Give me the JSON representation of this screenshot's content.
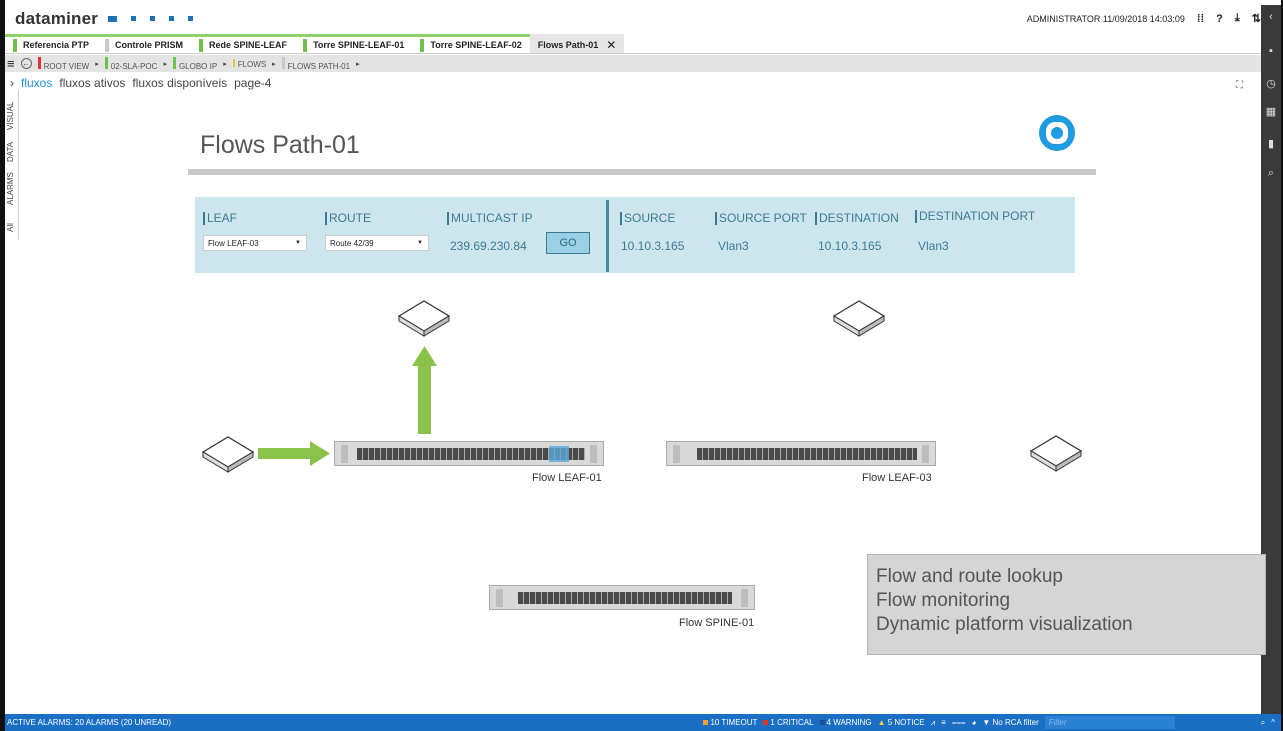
{
  "app": {
    "logo": "dataminer",
    "user_info": "ADMINISTRATOR 11/09/2018 14:03:09",
    "top_icons": [
      "grid-icon",
      "help-icon",
      "download-icon",
      "pin-icon"
    ],
    "top_icon_glyphs": [
      "⁞⁞",
      "?",
      "⤓",
      "⇅"
    ]
  },
  "tabs": [
    {
      "label": "Referencia PTP",
      "flag": "#6ec14a",
      "status": "x"
    },
    {
      "label": "Controle PRISM",
      "flag": "#c9c9c9",
      "status": "x"
    },
    {
      "label": "Rede SPINE-LEAF",
      "flag": "#6ec14a"
    },
    {
      "label": "Torre SPINE-LEAF-01",
      "flag": "#6ec14a"
    },
    {
      "label": "Torre SPINE-LEAF-02",
      "flag": "#6ec14a"
    },
    {
      "label": "Flows Path-01",
      "active": true
    }
  ],
  "breadcrumb": [
    "ROOT VIEW",
    "02-SLA-POC",
    "GLOBO IP",
    "FLOWS",
    "FLOWS PATH-01"
  ],
  "vertical_tabs": [
    "VISUAL",
    "DATA",
    "ALARMS",
    "All"
  ],
  "page_nav": {
    "items": [
      "fluxos",
      "fluxos ativos",
      "fluxos disponíveis",
      "page-4"
    ],
    "active": "fluxos"
  },
  "page": {
    "title": "Flows Path-01"
  },
  "panel": {
    "leaf_label": "LEAF",
    "leaf_value": "Flow LEAF-03",
    "route_label": "ROUTE",
    "route_value": "Route 42/39",
    "multicast_label": "MULTICAST IP",
    "multicast_value": "239.69.230.84",
    "go_label": "GO",
    "source_label": "SOURCE",
    "source_value": "10.10.3.165",
    "source_port_label": "SOURCE PORT",
    "source_port_value": "Vlan3",
    "destination_label": "DESTINATION",
    "destination_value": "10.10.3.165",
    "destination_port_label": "DESTINATION PORT",
    "destination_port_value": "Vlan3"
  },
  "devices": {
    "leaf01": "Flow LEAF-01",
    "leaf03": "Flow LEAF-03",
    "spine01": "Flow SPINE-01"
  },
  "info_box": [
    "Flow and route lookup",
    "Flow monitoring",
    "Dynamic platform visualization"
  ],
  "status_bar": {
    "alarms": "ACTIVE ALARMS: 20 ALARMS (20 UNREAD)",
    "timeout": "10 TIMEOUT",
    "critical": "1 CRITICAL",
    "warning": "4 WARNING",
    "notice": "5 NOTICE",
    "rca": "No RCA filter",
    "filter_placeholder": "Filter"
  },
  "colors": {
    "accent": "#1f9be0",
    "arrow": "#8bc34a",
    "panel": "#cde6ee",
    "statusbar": "#1a6fc4"
  }
}
